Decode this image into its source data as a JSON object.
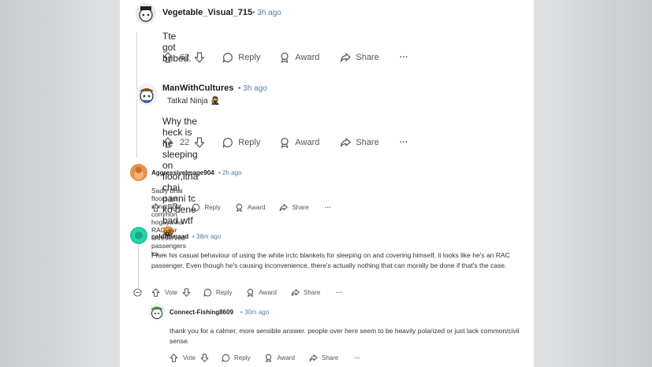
{
  "comments": [
    {
      "author": "Vegetable_Visual_715",
      "time": "3h ago",
      "body": "Tte got bribed.",
      "votes": "62",
      "reply": "Reply",
      "award": "Award",
      "share": "Share",
      "more": "···"
    },
    {
      "author": "ManWithCultures",
      "time": "3h ago",
      "flair": "Tatkal Ninja 🥷",
      "body": "Why the heck is he sleeping on floor,itna chai panni tc ko dene bad wtf 🤬",
      "votes": "22",
      "reply": "Reply",
      "award": "Award",
      "share": "Share",
      "more": "···"
    },
    {
      "author": "AggressiveImage904",
      "time": "2h ago",
      "body": "Sadly bhai floors pe sona Boht common hogaya hai RAC aur unreserved passengers ka. ..",
      "votes": "2",
      "reply": "Reply",
      "award": "Award",
      "share": "Share",
      "more": "···"
    },
    {
      "author": "coldnomaad",
      "time": "38m ago",
      "body": "From his casual behaviour of using the white irctc blankets for sleeping on and covering himself, it looks like he's an RAC passenger. Even though he's causing inconvenience, there's actually nothing that can morally be done if that's the case.",
      "votes": "Vote",
      "reply": "Reply",
      "award": "Award",
      "share": "Share",
      "more": "···"
    },
    {
      "author": "Connect-Fishing8609",
      "time": "30m ago",
      "body": "thank you for a calmer, more sensible answer. people over here seem to be heavily polarized or just lack common/civil sense.",
      "votes": "Vote",
      "reply": "Reply",
      "award": "Award",
      "share": "Share",
      "more": "···"
    }
  ],
  "colors": {
    "time": "#4f7fa6",
    "avatar_orange": "#e8914a",
    "avatar_teal": "#1fc59a"
  },
  "icons": [
    "upvote-icon",
    "downvote-icon",
    "reply-icon",
    "award-icon",
    "share-icon",
    "collapse-icon",
    "more-icon"
  ]
}
